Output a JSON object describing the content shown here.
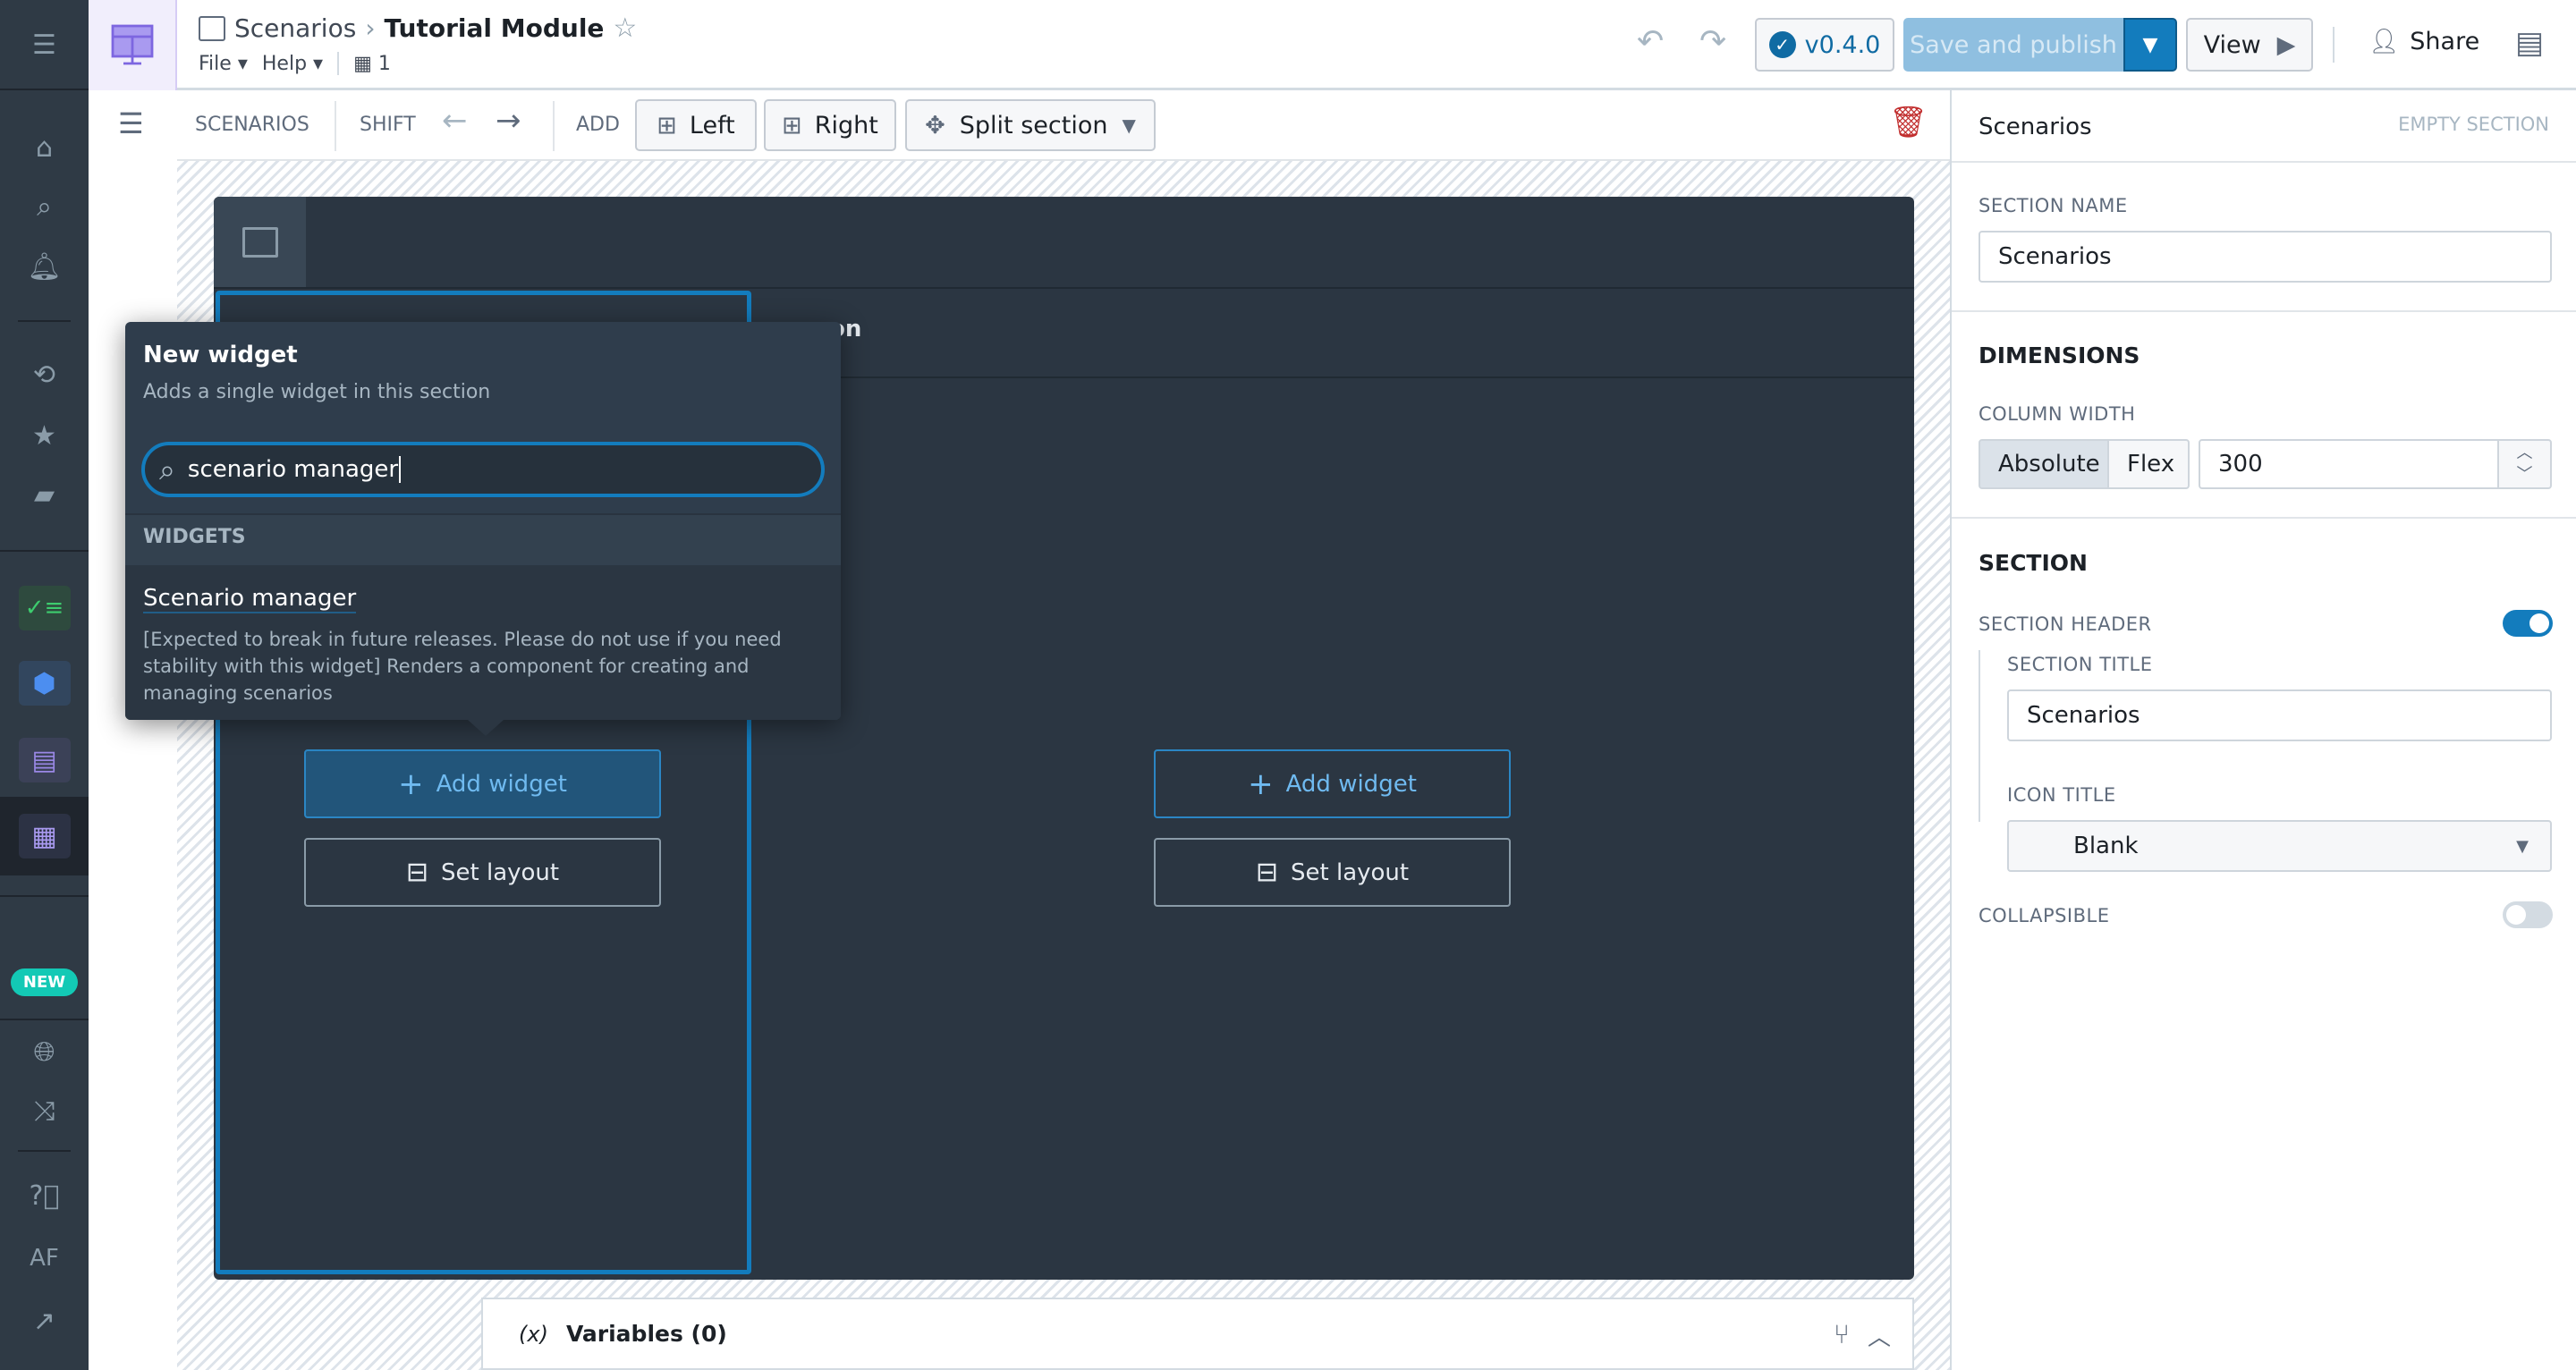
{
  "header": {
    "breadcrumb_parent": "Scenarios",
    "title": "Tutorial Module",
    "menu_file": "File",
    "menu_help": "Help",
    "org_count": "1",
    "version": "v0.4.0",
    "save_publish": "Save and publish",
    "view": "View",
    "share": "Share"
  },
  "nav": {
    "new_badge": "NEW",
    "user_initials": "AF"
  },
  "toolbar": {
    "section_label": "SCENARIOS",
    "shift_label": "SHIFT",
    "add_label": "ADD",
    "left": "Left",
    "right": "Right",
    "split": "Split section"
  },
  "canvas": {
    "partial_header": "on",
    "add_widget": "Add widget",
    "set_layout": "Set layout",
    "variables": "Variables (0)",
    "variables_icon": "(x)"
  },
  "popover": {
    "title": "New widget",
    "subtitle": "Adds a single widget in this section",
    "search_value": "scenario manager",
    "group_label": "WIDGETS",
    "result_title": "Scenario manager",
    "result_desc": "[Expected to break in future releases. Please do not use if you need stability with this widget] Renders a component for creating and managing scenarios"
  },
  "panel": {
    "title": "Scenarios",
    "status": "EMPTY SECTION",
    "section_name_label": "SECTION NAME",
    "section_name": "Scenarios",
    "dimensions": "DIMENSIONS",
    "column_width_label": "COLUMN WIDTH",
    "absolute": "Absolute",
    "flex": "Flex",
    "width_value": "300",
    "section": "SECTION",
    "section_header_label": "SECTION HEADER",
    "section_header_on": true,
    "section_title_label": "SECTION TITLE",
    "section_title": "Scenarios",
    "icon_title_label": "ICON TITLE",
    "icon_title": "Blank",
    "collapsible_label": "COLLAPSIBLE",
    "collapsible_on": false
  },
  "colors": {
    "accent": "#2d72d2",
    "primary": "#137cbd",
    "danger": "#c23030",
    "new_badge": "#13c9b5",
    "nav_bg": "#2f3a45",
    "module_bg": "#2b3642"
  }
}
